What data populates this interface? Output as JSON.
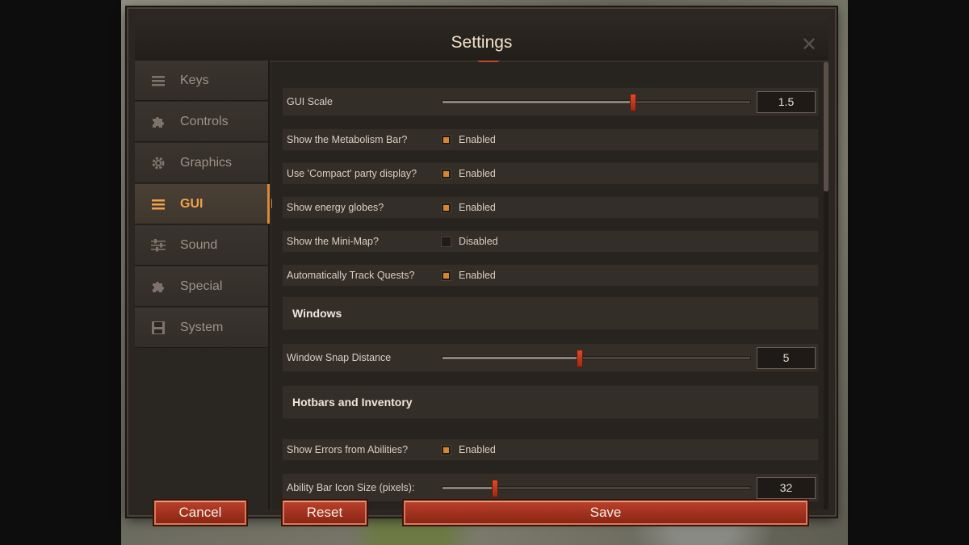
{
  "window": {
    "title": "Settings",
    "close_glyph": "✕"
  },
  "sidebar": {
    "items": [
      {
        "label": "Keys",
        "icon": "list-icon"
      },
      {
        "label": "Controls",
        "icon": "puzzle-icon"
      },
      {
        "label": "Graphics",
        "icon": "gear-icon"
      },
      {
        "label": "GUI",
        "icon": "list-icon",
        "active": true
      },
      {
        "label": "Sound",
        "icon": "sliders-icon"
      },
      {
        "label": "Special",
        "icon": "puzzle-icon"
      },
      {
        "label": "System",
        "icon": "save-icon"
      }
    ]
  },
  "settings": {
    "gui_scale": {
      "label": "GUI Scale",
      "value": "1.5",
      "fraction": 0.62
    },
    "metabolism": {
      "label": "Show the Metabolism Bar?",
      "state": "Enabled",
      "checked": true
    },
    "compact_party": {
      "label": "Use 'Compact' party display?",
      "state": "Enabled",
      "checked": true
    },
    "energy_globes": {
      "label": "Show energy globes?",
      "state": "Enabled",
      "checked": true
    },
    "mini_map": {
      "label": "Show the Mini-Map?",
      "state": "Disabled",
      "checked": false
    },
    "track_quests": {
      "label": "Automatically Track Quests?",
      "state": "Enabled",
      "checked": true
    },
    "windows_header": "Windows",
    "snap_distance": {
      "label": "Window Snap Distance",
      "value": "5",
      "fraction": 0.445
    },
    "hotbars_header": "Hotbars and Inventory",
    "show_errors": {
      "label": "Show Errors from Abilities?",
      "state": "Enabled",
      "checked": true
    },
    "icon_size": {
      "label": "Ability Bar Icon Size (pixels):",
      "value": "32",
      "fraction": 0.17
    }
  },
  "buttons": {
    "cancel": "Cancel",
    "reset": "Reset",
    "save": "Save"
  },
  "colors": {
    "accent": "#f2a24a",
    "button": "#b8402a",
    "checkbox_on": "#d9852e"
  }
}
